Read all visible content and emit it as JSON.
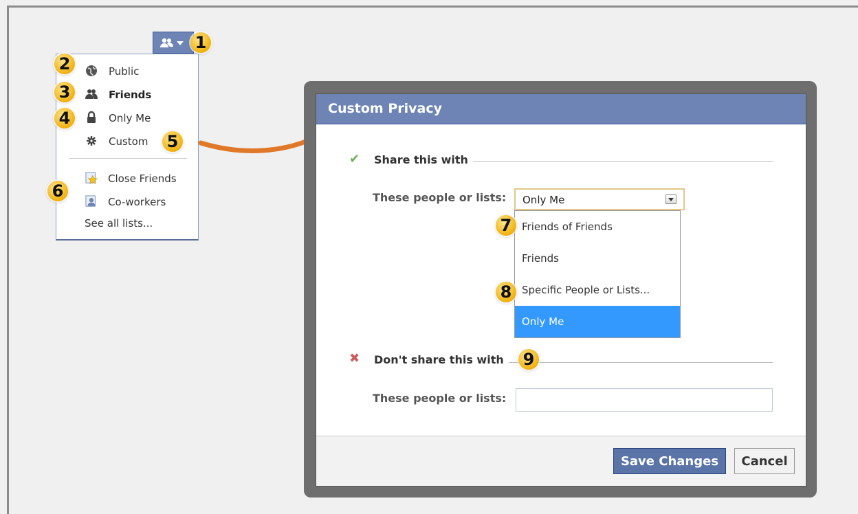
{
  "audience_menu": {
    "button_icon": "friends-icon",
    "items": [
      {
        "label": "Public",
        "icon": "globe-icon"
      },
      {
        "label": "Friends",
        "icon": "friends-icon",
        "selected": true
      },
      {
        "label": "Only Me",
        "icon": "lock-icon"
      },
      {
        "label": "Custom",
        "icon": "gear-icon"
      }
    ],
    "lists": [
      {
        "label": "Close Friends",
        "icon": "star-list-icon"
      },
      {
        "label": "Co-workers",
        "icon": "coworkers-icon"
      }
    ],
    "see_all": "See all lists..."
  },
  "badges": [
    "1",
    "2",
    "3",
    "4",
    "5",
    "6",
    "7",
    "8",
    "9"
  ],
  "dialog": {
    "title": "Custom Privacy",
    "share_section": "Share this with",
    "share_label": "These people or lists:",
    "share_select_value": "Only Me",
    "share_options": [
      {
        "label": "Friends of Friends"
      },
      {
        "label": "Friends"
      },
      {
        "label": "Specific People or Lists..."
      },
      {
        "label": "Only Me",
        "selected": true
      }
    ],
    "dont_share_section": "Don't share this with",
    "dont_share_label": "These people or lists:",
    "dont_share_value": "",
    "save_button": "Save Changes",
    "cancel_button": "Cancel"
  },
  "colors": {
    "header_blue": "#6d84b4",
    "button_blue": "#5b74a8",
    "selected_option": "#3399ff",
    "badge_gold": "#f2b10e",
    "arrow_orange": "#e0782a"
  }
}
